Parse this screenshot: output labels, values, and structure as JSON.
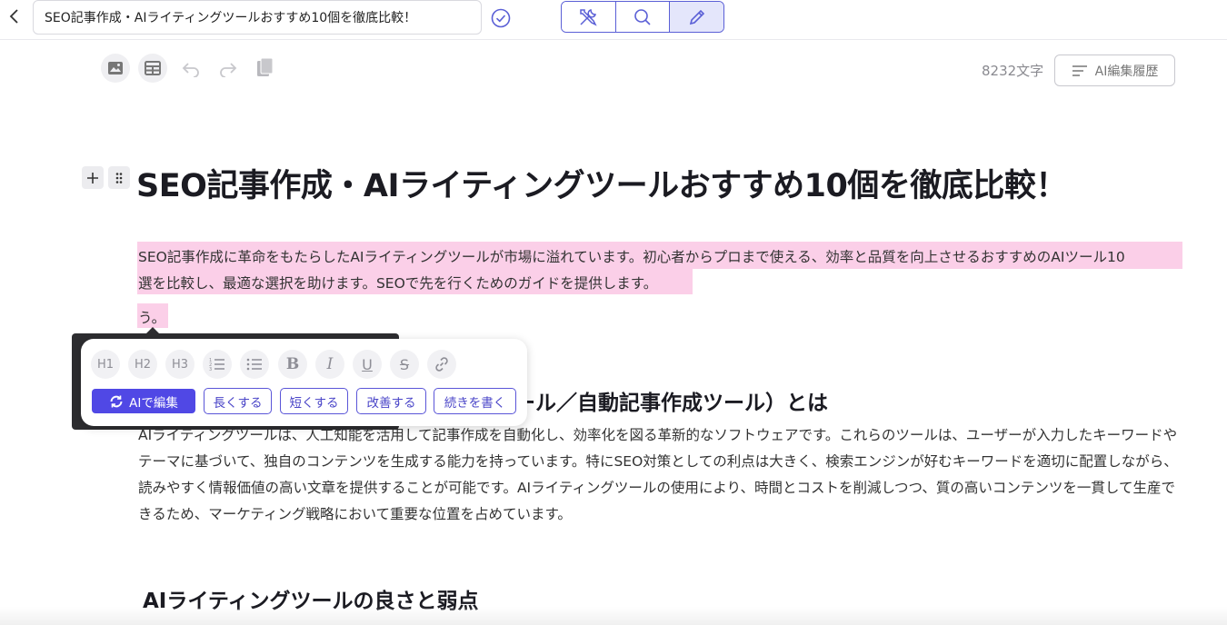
{
  "header": {
    "title_value": "SEO記事作成・AIライティングツールおすすめ10個を徹底比較！",
    "back_icon": "chevron-left-icon",
    "confirm_icon": "check-circle-icon",
    "modes": [
      {
        "name": "tools",
        "icon": "wrench-screwdriver-icon"
      },
      {
        "name": "search",
        "icon": "search-icon"
      },
      {
        "name": "edit",
        "icon": "pencil-icon",
        "active": true
      }
    ],
    "accent_color": "#5a5fd6"
  },
  "toolbar": {
    "char_count": "8232文字",
    "history_label": "AI編集履歴",
    "icons": [
      "image-icon",
      "table-icon",
      "undo-icon",
      "redo-icon",
      "copy-icon"
    ]
  },
  "document": {
    "title": "SEO記事作成・AIライティングツールおすすめ10個を徹底比較！",
    "intro_line1": "SEO記事作成に革命をもたらしたAIライティングツールが市場に溢れています。初心者からプロまで使える、効率と品質を向上させるおすすめのAIツール10",
    "intro_line2": "選を比較し、最適な選択を助けます。SEOで先を行くためのガイドを提供します。",
    "intro_line3": "う。",
    "highlight_color": "#fbcfe8",
    "heading1_visible_part": "ール／自動記事作成ツール）とは",
    "para1": "AIライティングツールは、人工知能を活用して記事作成を自動化し、効率化を図る革新的なソフトウェアです。これらのツールは、ユーザーが入力したキーワードやテーマに基づいて、独自のコンテンツを生成する能力を持っています。特にSEO対策としての利点は大きく、検索エンジンが好むキーワードを適切に配置しながら、読みやすく情報価値の高い文章を提供することが可能です。AIライティングツールの使用により、時間とコストを削減しつつ、質の高いコンテンツを一貫して生産できるため、マーケティング戦略において重要な位置を占めています。",
    "heading2": "AIライティングツールの良さと弱点"
  },
  "popover": {
    "format_buttons": [
      {
        "label": "H1",
        "icon": "heading1-icon"
      },
      {
        "label": "H2",
        "icon": "heading2-icon"
      },
      {
        "label": "H3",
        "icon": "heading3-icon"
      },
      {
        "label": "",
        "icon": "ordered-list-icon"
      },
      {
        "label": "",
        "icon": "bullet-list-icon"
      },
      {
        "label": "B",
        "icon": "bold-icon"
      },
      {
        "label": "I",
        "icon": "italic-icon"
      },
      {
        "label": "U",
        "icon": "underline-icon"
      },
      {
        "label": "S",
        "icon": "strikethrough-icon"
      },
      {
        "label": "",
        "icon": "link-icon"
      }
    ],
    "ai_edit_label": "AIで編集",
    "actions": [
      "長くする",
      "短くする",
      "改善する",
      "続きを書く"
    ],
    "ai_color": "#5048e5"
  }
}
